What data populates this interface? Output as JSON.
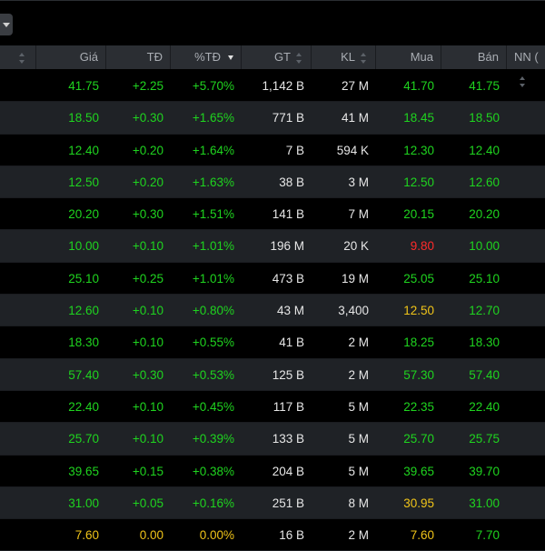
{
  "colors": {
    "up": "#1fd41f",
    "reference": "#f0c419",
    "down": "#ff2a2a",
    "neutral": "#e6e6e6",
    "header_bg": "#2b2e33",
    "alt_row_bg": "#1f2226"
  },
  "table": {
    "headers": [
      {
        "label": "",
        "sort": "both"
      },
      {
        "label": "Giá",
        "sort": "none"
      },
      {
        "label": "TĐ",
        "sort": "none"
      },
      {
        "label": "%TĐ",
        "sort": "desc"
      },
      {
        "label": "GT",
        "sort": "both"
      },
      {
        "label": "KL",
        "sort": "both"
      },
      {
        "label": "Mua",
        "sort": "none"
      },
      {
        "label": "Bán",
        "sort": "none"
      },
      {
        "label": "NN (",
        "sort": "none"
      }
    ],
    "rows": [
      {
        "gia": "41.75",
        "td": "+2.25",
        "pct": "+5.70%",
        "gt": "1,142 B",
        "kl": "27 M",
        "mua": "41.70",
        "ban": "41.75",
        "mua_state": "up",
        "state": "up"
      },
      {
        "gia": "18.50",
        "td": "+0.30",
        "pct": "+1.65%",
        "gt": "771 B",
        "kl": "41 M",
        "mua": "18.45",
        "ban": "18.50",
        "mua_state": "up",
        "state": "up"
      },
      {
        "gia": "12.40",
        "td": "+0.20",
        "pct": "+1.64%",
        "gt": "7 B",
        "kl": "594 K",
        "mua": "12.30",
        "ban": "12.40",
        "mua_state": "up",
        "state": "up"
      },
      {
        "gia": "12.50",
        "td": "+0.20",
        "pct": "+1.63%",
        "gt": "38 B",
        "kl": "3 M",
        "mua": "12.50",
        "ban": "12.60",
        "mua_state": "up",
        "state": "up"
      },
      {
        "gia": "20.20",
        "td": "+0.30",
        "pct": "+1.51%",
        "gt": "141 B",
        "kl": "7 M",
        "mua": "20.15",
        "ban": "20.20",
        "mua_state": "up",
        "state": "up"
      },
      {
        "gia": "10.00",
        "td": "+0.10",
        "pct": "+1.01%",
        "gt": "196 M",
        "kl": "20 K",
        "mua": "9.80",
        "ban": "10.00",
        "mua_state": "down",
        "state": "up"
      },
      {
        "gia": "25.10",
        "td": "+0.25",
        "pct": "+1.01%",
        "gt": "473 B",
        "kl": "19 M",
        "mua": "25.05",
        "ban": "25.10",
        "mua_state": "up",
        "state": "up"
      },
      {
        "gia": "12.60",
        "td": "+0.10",
        "pct": "+0.80%",
        "gt": "43 M",
        "kl": "3,400",
        "mua": "12.50",
        "ban": "12.70",
        "mua_state": "ref",
        "state": "up"
      },
      {
        "gia": "18.30",
        "td": "+0.10",
        "pct": "+0.55%",
        "gt": "41 B",
        "kl": "2 M",
        "mua": "18.25",
        "ban": "18.30",
        "mua_state": "up",
        "state": "up"
      },
      {
        "gia": "57.40",
        "td": "+0.30",
        "pct": "+0.53%",
        "gt": "125 B",
        "kl": "2 M",
        "mua": "57.30",
        "ban": "57.40",
        "mua_state": "up",
        "state": "up"
      },
      {
        "gia": "22.40",
        "td": "+0.10",
        "pct": "+0.45%",
        "gt": "117 B",
        "kl": "5 M",
        "mua": "22.35",
        "ban": "22.40",
        "mua_state": "up",
        "state": "up"
      },
      {
        "gia": "25.70",
        "td": "+0.10",
        "pct": "+0.39%",
        "gt": "133 B",
        "kl": "5 M",
        "mua": "25.70",
        "ban": "25.75",
        "mua_state": "up",
        "state": "up"
      },
      {
        "gia": "39.65",
        "td": "+0.15",
        "pct": "+0.38%",
        "gt": "204 B",
        "kl": "5 M",
        "mua": "39.65",
        "ban": "39.70",
        "mua_state": "up",
        "state": "up"
      },
      {
        "gia": "31.00",
        "td": "+0.05",
        "pct": "+0.16%",
        "gt": "251 B",
        "kl": "8 M",
        "mua": "30.95",
        "ban": "31.00",
        "mua_state": "ref",
        "state": "up"
      },
      {
        "gia": "7.60",
        "td": "0.00",
        "pct": "0.00%",
        "gt": "16 B",
        "kl": "2 M",
        "mua": "7.60",
        "ban": "7.70",
        "mua_state": "ref",
        "state": "ref",
        "ban_state": "up"
      }
    ]
  }
}
